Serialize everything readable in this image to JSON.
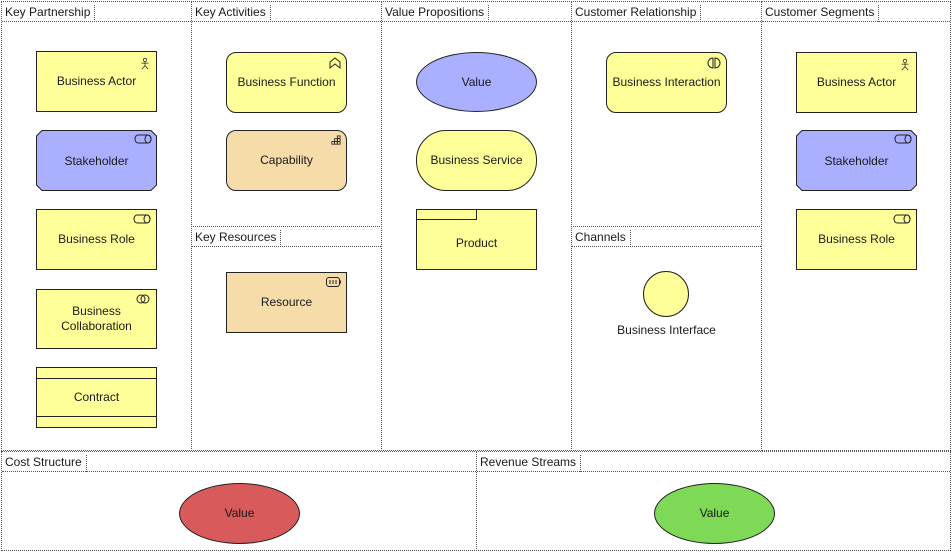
{
  "canvas": {
    "lanes": {
      "key_partnership": "Key Partnership",
      "key_activities": "Key Activities",
      "key_resources": "Key Resources",
      "value_propositions": "Value Propositions",
      "customer_relationship": "Customer Relationship",
      "channels": "Channels",
      "customer_segments": "Customer Segments",
      "cost_structure": "Cost Structure",
      "revenue_streams": "Revenue Streams"
    },
    "elements": {
      "kp_actor": "Business Actor",
      "kp_stakeholder": "Stakeholder",
      "kp_role": "Business Role",
      "kp_collab_1": "Business",
      "kp_collab_2": "Collaboration",
      "kp_contract": "Contract",
      "ka_function": "Business Function",
      "ka_capability": "Capability",
      "kr_resource": "Resource",
      "vp_value": "Value",
      "vp_service": "Business Service",
      "vp_product": "Product",
      "cr_interaction": "Business Interaction",
      "ch_interface": "Business Interface",
      "cs_actor": "Business Actor",
      "cs_stakeholder": "Stakeholder",
      "cs_role": "Business Role",
      "cost_value": "Value",
      "revenue_value": "Value"
    },
    "colors": {
      "business_yellow": "#ffff99",
      "motivation_blue": "#aab0ff",
      "strategy_tan": "#f5dca8",
      "cost_red": "#d95a5a",
      "revenue_green": "#7ed957"
    }
  }
}
